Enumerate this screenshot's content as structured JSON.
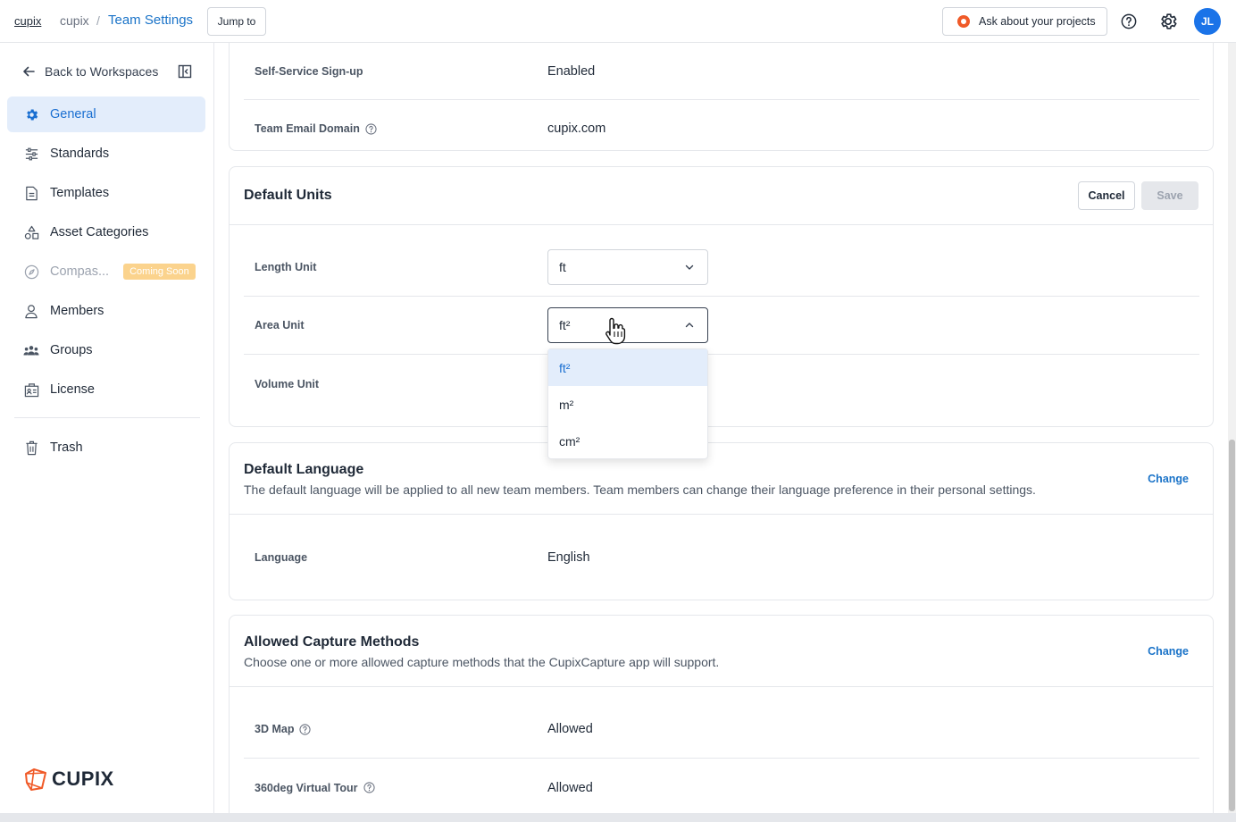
{
  "topbar": {
    "logo": "cupix",
    "crumb_workspace": "cupix",
    "crumb_separator": "/",
    "crumb_current": "Team Settings",
    "jump_to": "Jump to",
    "ask": "Ask about your projects",
    "avatar_initials": "JL"
  },
  "sidebar": {
    "back": "Back to Workspaces",
    "items": [
      {
        "label": "General",
        "icon": "gear-icon",
        "active": true
      },
      {
        "label": "Standards",
        "icon": "sliders-icon"
      },
      {
        "label": "Templates",
        "icon": "document-icon"
      },
      {
        "label": "Asset Categories",
        "icon": "shapes-icon"
      },
      {
        "label": "Compas...",
        "icon": "compass-icon",
        "disabled": true,
        "badge": "Coming Soon"
      },
      {
        "label": "Members",
        "icon": "user-icon"
      },
      {
        "label": "Groups",
        "icon": "group-icon"
      },
      {
        "label": "License",
        "icon": "license-icon"
      },
      {
        "label": "Trash",
        "icon": "trash-icon"
      }
    ],
    "brand": "CUPIX"
  },
  "team_info": {
    "signup_label": "Self-Service Sign-up",
    "signup_value": "Enabled",
    "domain_label": "Team Email Domain",
    "domain_value": "cupix.com"
  },
  "default_units": {
    "title": "Default Units",
    "cancel": "Cancel",
    "save": "Save",
    "length_label": "Length Unit",
    "length_value": "ft",
    "area_label": "Area Unit",
    "area_value": "ft²",
    "volume_label": "Volume Unit",
    "area_options": [
      "ft²",
      "m²",
      "cm²"
    ]
  },
  "default_language": {
    "title": "Default Language",
    "description": "The default language will be applied to all new team members. Team members can change their language preference in their personal settings.",
    "change": "Change",
    "language_label": "Language",
    "language_value": "English"
  },
  "capture_methods": {
    "title": "Allowed Capture Methods",
    "description": "Choose one or more allowed capture methods that the CupixCapture app will support.",
    "change": "Change",
    "map_label": "3D Map",
    "map_value": "Allowed",
    "tour_label": "360deg Virtual Tour",
    "tour_value": "Allowed"
  },
  "colors": {
    "accent": "#1a73c8",
    "active_bg": "#e3edfb",
    "badge": "#fbd38d",
    "avatar": "#1a73e8",
    "brand_orange": "#f05a28"
  }
}
